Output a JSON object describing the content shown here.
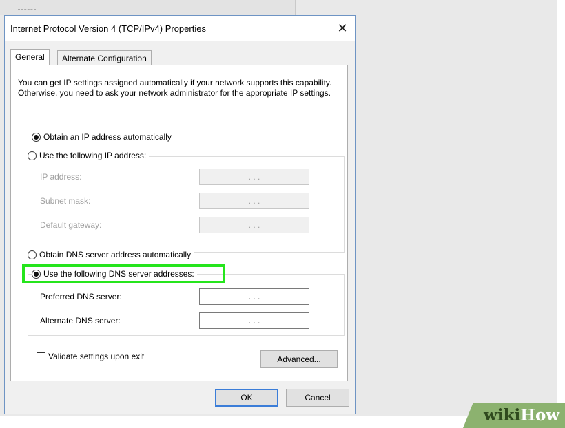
{
  "dialog": {
    "title": "Internet Protocol Version 4 (TCP/IPv4) Properties",
    "close_glyph": "✕"
  },
  "tabs": [
    {
      "label": "General",
      "active": true
    },
    {
      "label": "Alternate Configuration",
      "active": false
    }
  ],
  "description": "You can get IP settings assigned automatically if your network supports this capability. Otherwise, you need to ask your network administrator for the appropriate IP settings.",
  "ip_options": {
    "auto_label": "Obtain an IP address automatically",
    "auto_checked": true,
    "manual_label": "Use the following IP address:",
    "manual_checked": false
  },
  "ip_fields": [
    {
      "label": "IP address:",
      "value": ".   .   ."
    },
    {
      "label": "Subnet mask:",
      "value": ".   .   ."
    },
    {
      "label": "Default gateway:",
      "value": ".   .   ."
    }
  ],
  "dns_options": {
    "auto_label": "Obtain DNS server address automatically",
    "auto_checked": false,
    "manual_label": "Use the following DNS server addresses:",
    "manual_checked": true
  },
  "dns_fields": [
    {
      "label": "Preferred DNS server:",
      "value": ".   .   ."
    },
    {
      "label": "Alternate DNS server:",
      "value": ".   .   ."
    }
  ],
  "validate_label": "Validate settings upon exit",
  "validate_checked": false,
  "buttons": {
    "advanced": "Advanced...",
    "ok": "OK",
    "cancel": "Cancel"
  },
  "watermark": {
    "part1": "wiki",
    "part2": "How"
  },
  "colors": {
    "highlight": "#25e51c",
    "accent_border": "#3b7dd8"
  }
}
